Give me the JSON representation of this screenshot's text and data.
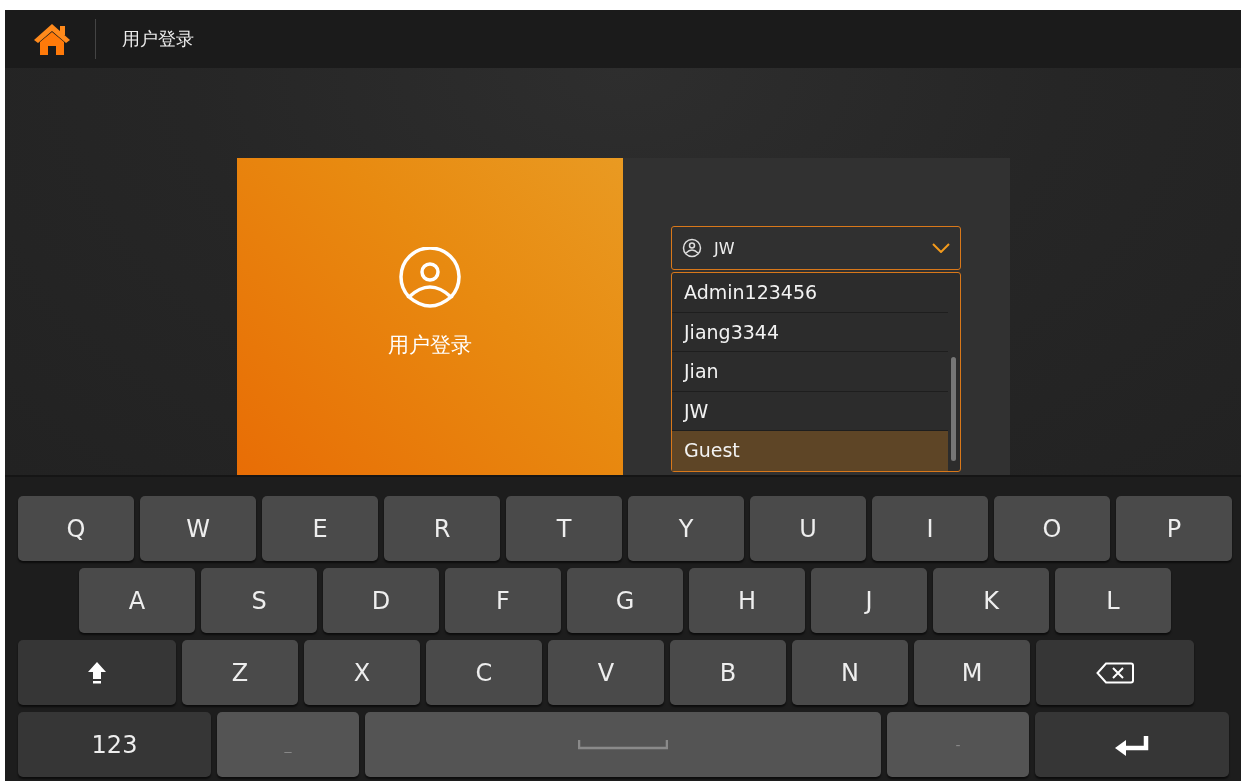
{
  "header": {
    "title": "用户登录"
  },
  "login_card": {
    "label": "用户登录"
  },
  "user_select": {
    "value": "JW",
    "expanded": true,
    "options": [
      {
        "label": "Admin123456",
        "highlighted": false
      },
      {
        "label": "Jiang3344",
        "highlighted": false
      },
      {
        "label": "Jian",
        "highlighted": false
      },
      {
        "label": "JW",
        "highlighted": false
      },
      {
        "label": "Guest",
        "highlighted": true
      }
    ]
  },
  "keyboard": {
    "rows": [
      [
        {
          "kind": "letter",
          "label": "Q"
        },
        {
          "kind": "letter",
          "label": "W"
        },
        {
          "kind": "letter",
          "label": "E"
        },
        {
          "kind": "letter",
          "label": "R"
        },
        {
          "kind": "letter",
          "label": "T"
        },
        {
          "kind": "letter",
          "label": "Y"
        },
        {
          "kind": "letter",
          "label": "U"
        },
        {
          "kind": "letter",
          "label": "I"
        },
        {
          "kind": "letter",
          "label": "O"
        },
        {
          "kind": "letter",
          "label": "P"
        }
      ],
      [
        {
          "kind": "letter",
          "label": "A"
        },
        {
          "kind": "letter",
          "label": "S"
        },
        {
          "kind": "letter",
          "label": "D"
        },
        {
          "kind": "letter",
          "label": "F"
        },
        {
          "kind": "letter",
          "label": "G"
        },
        {
          "kind": "letter",
          "label": "H"
        },
        {
          "kind": "letter",
          "label": "J"
        },
        {
          "kind": "letter",
          "label": "K"
        },
        {
          "kind": "letter",
          "label": "L"
        }
      ],
      [
        {
          "kind": "shift"
        },
        {
          "kind": "letter",
          "label": "Z"
        },
        {
          "kind": "letter",
          "label": "X"
        },
        {
          "kind": "letter",
          "label": "C"
        },
        {
          "kind": "letter",
          "label": "V"
        },
        {
          "kind": "letter",
          "label": "B"
        },
        {
          "kind": "letter",
          "label": "N"
        },
        {
          "kind": "letter",
          "label": "M"
        },
        {
          "kind": "backspace"
        }
      ],
      [
        {
          "kind": "mode",
          "label": "123"
        },
        {
          "kind": "symbol",
          "label": "_"
        },
        {
          "kind": "space"
        },
        {
          "kind": "symbol",
          "label": "-"
        },
        {
          "kind": "enter"
        }
      ]
    ]
  }
}
